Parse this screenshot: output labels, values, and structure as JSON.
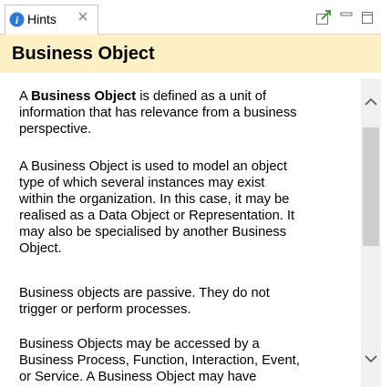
{
  "tab": {
    "label": "Hints",
    "icon": "info-icon",
    "close_icon": "close-icon"
  },
  "toolbar": {
    "link_icon": "link-with-editor-icon",
    "minimize_icon": "minimize-icon",
    "maximize_icon": "maximize-icon"
  },
  "header": {
    "title": "Business Object"
  },
  "content": {
    "p1_prefix": "A ",
    "p1_bold": "Business Object",
    "p1_line1_rest": " is defined as a unit of",
    "p1_line2": "information that has relevance from a business",
    "p1_line3": "perspective.",
    "p2_lines": [
      "A Business Object is used to model an object",
      "type of which several instances may exist",
      "within the organization. In this case, it may be",
      "realised as a Data Object or Representation. It",
      "may also be specialised by another Business",
      "Object."
    ],
    "p3_lines": [
      "Business objects are passive. They do not",
      "trigger or perform processes."
    ],
    "p4_lines": [
      "Business Objects may be accessed by a",
      "Business Process, Function, Interaction, Event,",
      "or Service. A Business Object may have"
    ]
  },
  "scrollbar": {
    "up_icon": "chevron-up-icon",
    "down_icon": "chevron-down-icon"
  },
  "colors": {
    "header_bg": "#fdf0c5",
    "info_blue": "#2b79d0",
    "pin_green": "#4a9a3a"
  }
}
